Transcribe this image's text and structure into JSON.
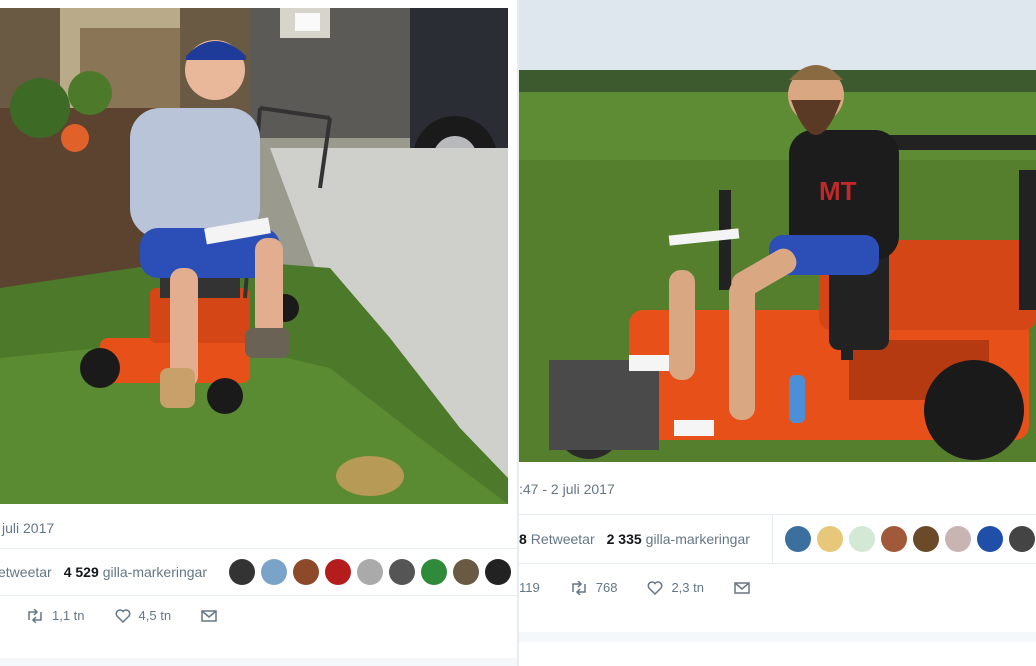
{
  "left_tweet": {
    "date": "juli 2017",
    "retweets_label": "etweetar",
    "likes_count": "4 529",
    "likes_label": "gilla-markeringar",
    "actions": {
      "retweets": "1,1 tn",
      "likes": "4,5 tn"
    },
    "icons": [
      "retweet-icon",
      "heart-icon",
      "mail-icon"
    ]
  },
  "right_tweet": {
    "date": ":47 - 2 juli 2017",
    "retweets_count": "8",
    "retweets_label": "Retweetar",
    "likes_count": "2 335",
    "likes_label": "gilla-markeringar",
    "actions": {
      "replies": "119",
      "retweets": "768",
      "likes": "2,3 tn"
    },
    "icons": [
      "retweet-icon",
      "heart-icon",
      "mail-icon"
    ]
  },
  "colors": {
    "text_secondary": "#657786",
    "divider": "#e6ecf0",
    "mower_orange": "#e8501a",
    "grass": "#4d7a2a"
  }
}
